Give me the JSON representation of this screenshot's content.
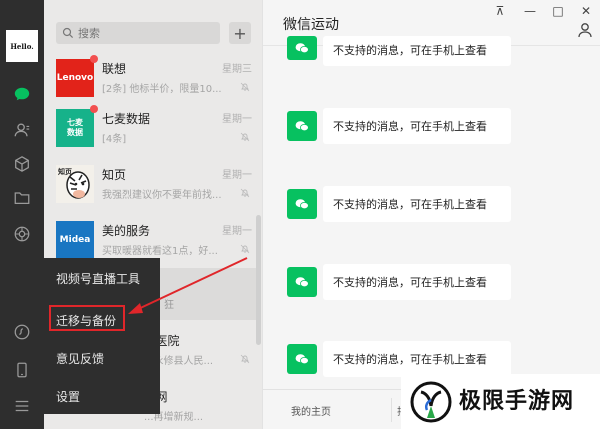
{
  "app": {
    "avatar_text": "Hello."
  },
  "search": {
    "placeholder": "搜索",
    "add_label": "+"
  },
  "chats": [
    {
      "name": "联想",
      "time": "星期三",
      "preview": "[2条] 他标半价，限量10...",
      "thumb_text": "Lenovo",
      "thumb_color": "#e2231a"
    },
    {
      "name": "七麦数据",
      "time": "星期一",
      "preview": "[4条]",
      "thumb_text": "七麦\n数据",
      "thumb_color": "#16b28a"
    },
    {
      "name": "知页",
      "time": "星期一",
      "preview": "我强烈建议你不要年前找...",
      "thumb_text": "知页",
      "thumb_color": "#f3f0ea"
    },
    {
      "name": "美的服务",
      "time": "星期一",
      "preview": "买取暖器就看这1点，好...",
      "thumb_text": "Midea",
      "thumb_color": "#1976c2"
    },
    {
      "name": "...医院",
      "time": "",
      "preview": "...永修县人民...",
      "thumb_text": "",
      "thumb_color": "#dcdbda"
    },
    {
      "name": "...网",
      "time": "",
      "preview": "...再增新规...",
      "thumb_text": "",
      "thumb_color": "#dcdbda"
    }
  ],
  "partial_text": "狂",
  "menu": {
    "items": [
      "视频号直播工具",
      "迁移与备份",
      "意见反馈",
      "设置"
    ]
  },
  "chat": {
    "title": "微信运动",
    "messages": [
      "不支持的消息，可在手机上查看",
      "不支持的消息，可在手机上查看",
      "不支持的消息，可在手机上查看",
      "不支持的消息，可在手机上查看",
      "不支持的消息，可在手机上查看"
    ],
    "footer_tabs": [
      "我的主页",
      "排"
    ]
  },
  "window_controls": [
    "⊼",
    "—",
    "□",
    "✕"
  ],
  "watermark": {
    "text": "极限手游网"
  },
  "colors": {
    "accent": "#07c160",
    "highlight": "#e0262a"
  }
}
